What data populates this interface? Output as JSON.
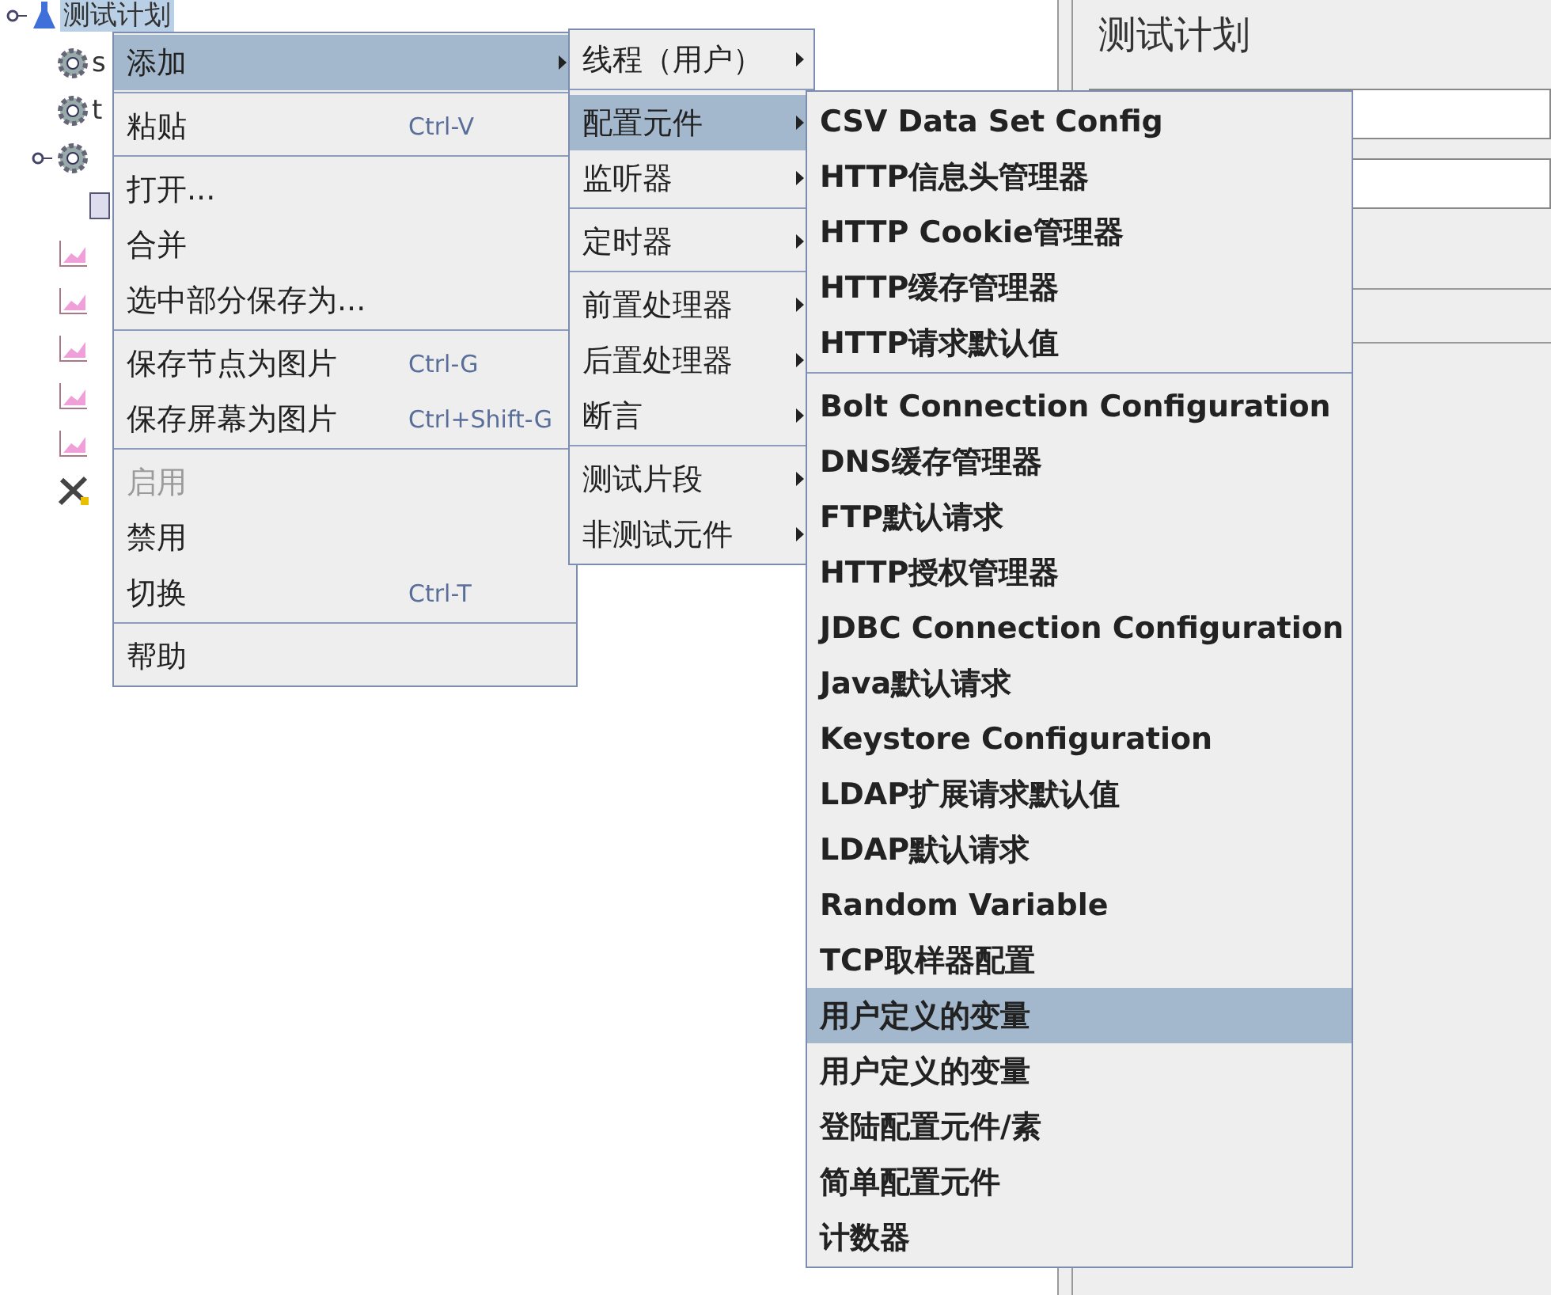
{
  "tree": {
    "label": "测试计划",
    "selected": true,
    "children": [
      {
        "label": "s",
        "kind": "gear"
      },
      {
        "label": "t",
        "kind": "gear"
      },
      {
        "kind": "gear",
        "children": [
          {
            "kind": "sampler"
          }
        ]
      },
      {
        "kind": "chart"
      },
      {
        "kind": "chart"
      },
      {
        "kind": "chart"
      },
      {
        "kind": "chart"
      },
      {
        "kind": "chart"
      },
      {
        "kind": "tool"
      }
    ]
  },
  "panel": {
    "title": "测试计划"
  },
  "context_menu": {
    "groups": [
      [
        {
          "label": "添加",
          "submenu": true,
          "selected": true,
          "disabled": false
        }
      ],
      [
        {
          "label": "粘贴",
          "shortcut": "Ctrl-V",
          "submenu": false,
          "selected": false,
          "disabled": false
        }
      ],
      [
        {
          "label": "打开...",
          "submenu": false,
          "selected": false,
          "disabled": false
        },
        {
          "label": "合并",
          "submenu": false,
          "selected": false,
          "disabled": false
        },
        {
          "label": "选中部分保存为...",
          "submenu": false,
          "selected": false,
          "disabled": false
        }
      ],
      [
        {
          "label": "保存节点为图片",
          "shortcut": "Ctrl-G",
          "submenu": false,
          "selected": false,
          "disabled": false
        },
        {
          "label": "保存屏幕为图片",
          "shortcut": "Ctrl+Shift-G",
          "submenu": false,
          "selected": false,
          "disabled": false
        }
      ],
      [
        {
          "label": "启用",
          "submenu": false,
          "selected": false,
          "disabled": true
        },
        {
          "label": "禁用",
          "submenu": false,
          "selected": false,
          "disabled": false
        },
        {
          "label": "切换",
          "shortcut": "Ctrl-T",
          "submenu": false,
          "selected": false,
          "disabled": false
        }
      ],
      [
        {
          "label": "帮助",
          "submenu": false,
          "selected": false,
          "disabled": false
        }
      ]
    ]
  },
  "add_submenu": {
    "groups": [
      [
        {
          "label": "线程（用户）",
          "submenu": true,
          "selected": false,
          "disabled": false
        }
      ],
      [
        {
          "label": "配置元件",
          "submenu": true,
          "selected": true,
          "disabled": false
        },
        {
          "label": "监听器",
          "submenu": true,
          "selected": false,
          "disabled": false
        }
      ],
      [
        {
          "label": "定时器",
          "submenu": true,
          "selected": false,
          "disabled": false
        }
      ],
      [
        {
          "label": "前置处理器",
          "submenu": true,
          "selected": false,
          "disabled": false
        },
        {
          "label": "后置处理器",
          "submenu": true,
          "selected": false,
          "disabled": false
        },
        {
          "label": "断言",
          "submenu": true,
          "selected": false,
          "disabled": false
        }
      ],
      [
        {
          "label": "测试片段",
          "submenu": true,
          "selected": false,
          "disabled": false
        },
        {
          "label": "非测试元件",
          "submenu": true,
          "selected": false,
          "disabled": false
        }
      ]
    ]
  },
  "config_submenu": {
    "groups": [
      [
        {
          "label": "CSV Data Set Config",
          "selected": false,
          "disabled": false
        },
        {
          "label": "HTTP信息头管理器",
          "selected": false,
          "disabled": false
        },
        {
          "label": "HTTP Cookie管理器",
          "selected": false,
          "disabled": false
        },
        {
          "label": "HTTP缓存管理器",
          "selected": false,
          "disabled": false
        },
        {
          "label": "HTTP请求默认值",
          "selected": false,
          "disabled": false
        }
      ],
      [
        {
          "label": "Bolt Connection Configuration",
          "selected": false,
          "disabled": false
        },
        {
          "label": "DNS缓存管理器",
          "selected": false,
          "disabled": false
        },
        {
          "label": "FTP默认请求",
          "selected": false,
          "disabled": false
        },
        {
          "label": "HTTP授权管理器",
          "selected": false,
          "disabled": false
        },
        {
          "label": "JDBC Connection Configuration",
          "selected": false,
          "disabled": false
        },
        {
          "label": "Java默认请求",
          "selected": false,
          "disabled": false
        },
        {
          "label": "Keystore Configuration",
          "selected": false,
          "disabled": false
        },
        {
          "label": "LDAP扩展请求默认值",
          "selected": false,
          "disabled": false
        },
        {
          "label": "LDAP默认请求",
          "selected": false,
          "disabled": false
        },
        {
          "label": "Random Variable",
          "selected": false,
          "disabled": false
        },
        {
          "label": "TCP取样器配置",
          "selected": false,
          "disabled": false
        },
        {
          "label": "用户定义的变量",
          "selected": true,
          "disabled": false
        },
        {
          "label": "用户定义的变量",
          "selected": false,
          "disabled": false
        },
        {
          "label": "登陆配置元件/素",
          "selected": false,
          "disabled": false
        },
        {
          "label": "简单配置元件",
          "selected": false,
          "disabled": false
        },
        {
          "label": "计数器",
          "selected": false,
          "disabled": false
        }
      ]
    ]
  }
}
